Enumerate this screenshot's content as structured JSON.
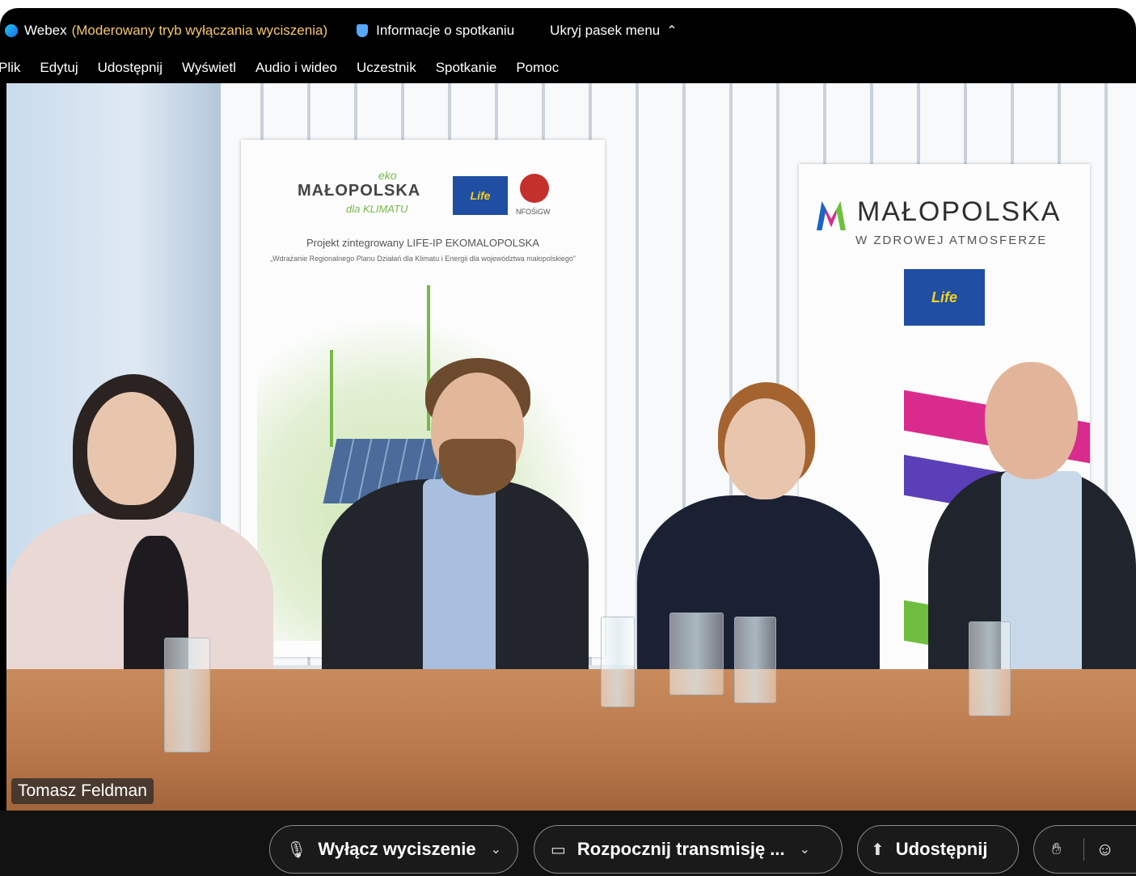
{
  "titlebar": {
    "app_name": "Webex",
    "mode": "(Moderowany tryb wyłączania wyciszenia)",
    "meeting_info": "Informacje o spotkaniu",
    "hide_menu": "Ukryj pasek menu"
  },
  "menubar": {
    "items": [
      "Plik",
      "Edytuj",
      "Udostępnij",
      "Wyświetl",
      "Audio i wideo",
      "Uczestnik",
      "Spotkanie",
      "Pomoc"
    ]
  },
  "video": {
    "speaker_name": "Tomasz Feldman",
    "banner_left": {
      "logo": "MAŁOPOLSKA",
      "eko": "eko",
      "klimat": "dla KLIMATU",
      "eu_label": "Life",
      "nfos": "NFOŚiGW",
      "project_title": "Projekt zintegrowany LIFE-IP EKOMALOPOLSKA",
      "project_sub": "„Wdrażanie Regionalnego Planu Działań dla Klimatu i Energii dla województwa małopolskiego”"
    },
    "banner_right": {
      "logo": "MAŁOPOLSKA",
      "subtitle": "W ZDROWEJ ATMOSFERZE",
      "eu_label": "Life"
    }
  },
  "controls": {
    "mute_label": "Wyłącz wyciszenie",
    "video_label": "Rozpocznij transmisję ...",
    "share_label": "Udostępnij"
  },
  "icons": {
    "mute": "mic-off-icon",
    "video": "video-off-icon",
    "share": "share-screen-icon",
    "hand": "raise-hand-icon",
    "reactions": "reactions-icon"
  },
  "colors": {
    "mode_text": "#f6c86a",
    "window_bg": "#000000",
    "bar_bg": "#121212"
  }
}
